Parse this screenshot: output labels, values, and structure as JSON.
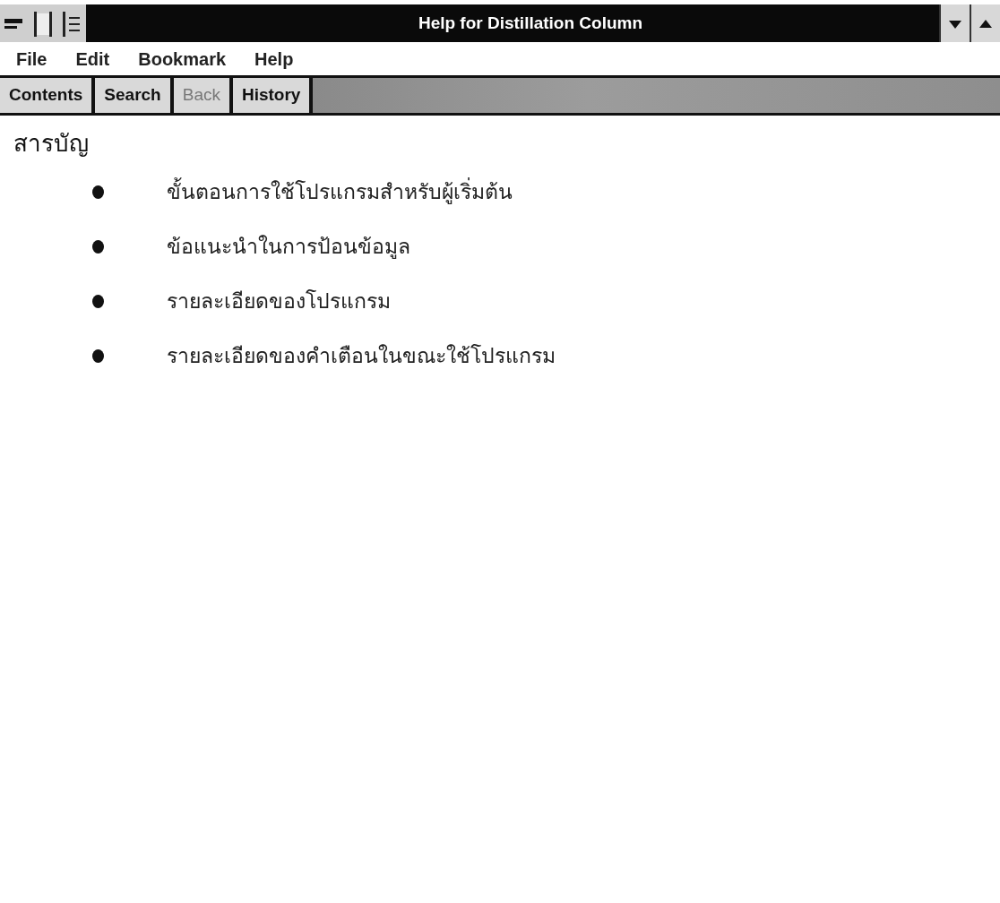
{
  "window": {
    "title": "Help for Distillation Column"
  },
  "menu": [
    "File",
    "Edit",
    "Bookmark",
    "Help"
  ],
  "toolbar": [
    {
      "label": "Contents",
      "disabled": false
    },
    {
      "label": "Search",
      "disabled": false
    },
    {
      "label": "Back",
      "disabled": true
    },
    {
      "label": "History",
      "disabled": false
    }
  ],
  "content": {
    "heading": "สารบัญ",
    "items": [
      "ขั้นตอนการใช้โปรแกรมสำหรับผู้เริ่มต้น",
      "ข้อแนะนำในการป้อนข้อมูล",
      "รายละเอียดของโปรแกรม",
      "รายละเอียดของคำเตือนในขณะใช้โปรแกรม"
    ]
  }
}
